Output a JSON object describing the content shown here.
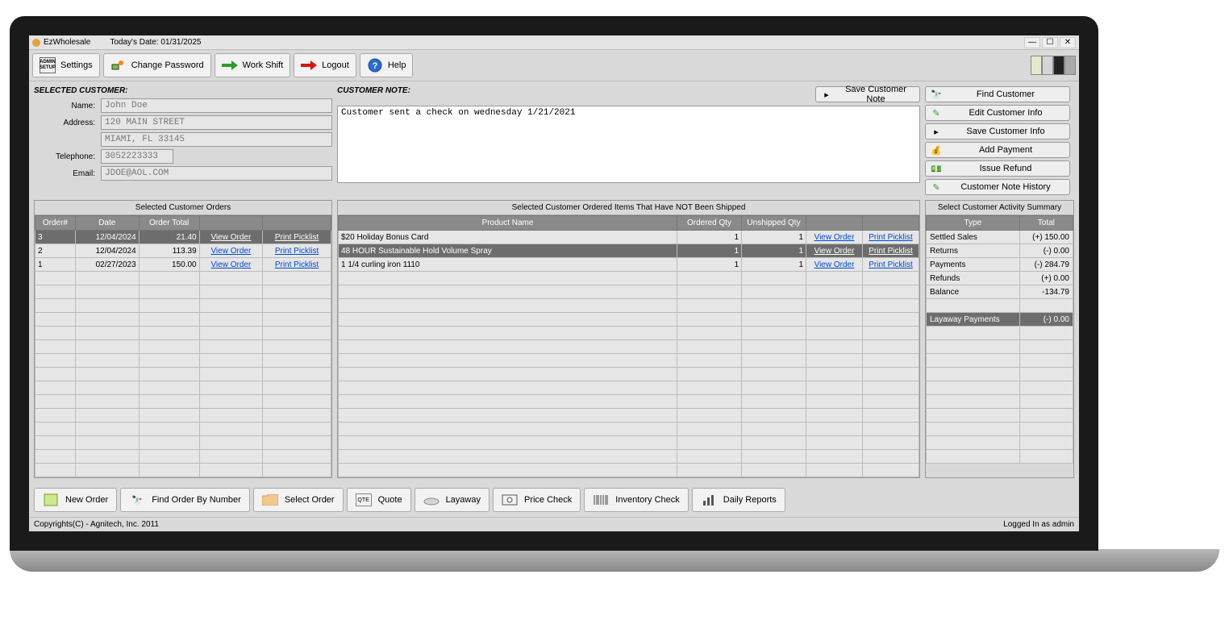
{
  "titlebar": {
    "app_name": "EzWholesale",
    "date_prefix": "Today's Date:",
    "date": "01/31/2025"
  },
  "toolbar": {
    "settings": "Settings",
    "change_password": "Change Password",
    "work_shift": "Work Shift",
    "logout": "Logout",
    "help": "Help"
  },
  "labels": {
    "selected_customer": "SELECTED CUSTOMER:",
    "name": "Name:",
    "address": "Address:",
    "telephone": "Telephone:",
    "email": "Email:",
    "customer_note": "CUSTOMER NOTE:",
    "save_note": "Save Customer Note"
  },
  "customer": {
    "name": "John Doe",
    "address1": "120 MAIN STREET",
    "address2": "MIAMI, FL 33145",
    "telephone": "3052223333",
    "email": "JDOE@AOL.COM",
    "note": "Customer sent a check on wednesday 1/21/2021"
  },
  "right_actions": {
    "find_customer": "Find Customer",
    "edit_customer": "Edit Customer Info",
    "save_customer": "Save Customer Info",
    "add_payment": "Add Payment",
    "issue_refund": "Issue Refund",
    "note_history": "Customer Note History"
  },
  "orders_panel": {
    "title": "Selected Customer Orders",
    "cols": [
      "Order#",
      "Date",
      "Order Total",
      "",
      ""
    ],
    "link_view": "View Order",
    "link_print": "Print Picklist",
    "rows": [
      {
        "order": "3",
        "date": "12/04/2024",
        "total": "21.40",
        "sel": true
      },
      {
        "order": "2",
        "date": "12/04/2024",
        "total": "113.39",
        "sel": false
      },
      {
        "order": "1",
        "date": "02/27/2023",
        "total": "150.00",
        "sel": false
      }
    ]
  },
  "unshipped_panel": {
    "title": "Selected Customer Ordered Items That Have NOT Been Shipped",
    "cols": [
      "Product Name",
      "Ordered Qty",
      "Unshipped Qty",
      "",
      ""
    ],
    "link_view": "View Order",
    "link_print": "Print Picklist",
    "rows": [
      {
        "product": "$20 Holiday Bonus Card",
        "ordered": "1",
        "unshipped": "1",
        "sel": false
      },
      {
        "product": "48 HOUR Sustainable Hold Volume Spray",
        "ordered": "1",
        "unshipped": "1",
        "sel": true
      },
      {
        "product": "1 1/4 curling iron 1110",
        "ordered": "1",
        "unshipped": "1",
        "sel": false
      }
    ]
  },
  "summary_panel": {
    "title": "Select Customer Activity Summary",
    "cols": [
      "Type",
      "Total"
    ],
    "rows": [
      {
        "type": "Settled Sales",
        "total": "(+) 150.00"
      },
      {
        "type": "Returns",
        "total": "(-) 0.00"
      },
      {
        "type": "Payments",
        "total": "(-) 284.79"
      },
      {
        "type": "Refunds",
        "total": "(+) 0.00"
      },
      {
        "type": "Balance",
        "total": "-134.79"
      }
    ],
    "layaway": {
      "type": "Layaway Payments",
      "total": "(-) 0.00"
    }
  },
  "bottom": {
    "new_order": "New Order",
    "find_order": "Find Order By Number",
    "select_order": "Select Order",
    "quote": "Quote",
    "layaway": "Layaway",
    "price_check": "Price Check",
    "inventory_check": "Inventory Check",
    "daily_reports": "Daily Reports"
  },
  "status": {
    "copyright": "Copyrights(C) - Agnitech, Inc. 2011",
    "login": "Logged In as admin"
  }
}
